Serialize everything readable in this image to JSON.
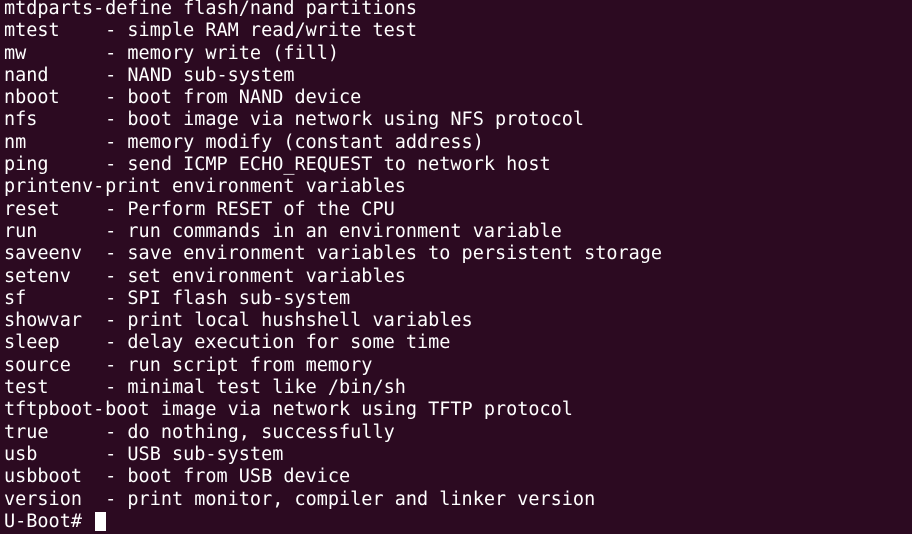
{
  "terminal": {
    "colors": {
      "background": "#2c0a21",
      "foreground": "#ffffff"
    },
    "lines": [
      {
        "cmd": "mtdparts-",
        "desc": " define flash/nand partitions"
      },
      {
        "cmd": "mtest   ",
        "desc": " - simple RAM read/write test"
      },
      {
        "cmd": "mw      ",
        "desc": " - memory write (fill)"
      },
      {
        "cmd": "nand    ",
        "desc": " - NAND sub-system"
      },
      {
        "cmd": "nboot   ",
        "desc": " - boot from NAND device"
      },
      {
        "cmd": "nfs     ",
        "desc": " - boot image via network using NFS protocol"
      },
      {
        "cmd": "nm      ",
        "desc": " - memory modify (constant address)"
      },
      {
        "cmd": "ping    ",
        "desc": " - send ICMP ECHO_REQUEST to network host"
      },
      {
        "cmd": "printenv-",
        "desc": " print environment variables"
      },
      {
        "cmd": "reset   ",
        "desc": " - Perform RESET of the CPU"
      },
      {
        "cmd": "run     ",
        "desc": " - run commands in an environment variable"
      },
      {
        "cmd": "saveenv ",
        "desc": " - save environment variables to persistent storage"
      },
      {
        "cmd": "setenv  ",
        "desc": " - set environment variables"
      },
      {
        "cmd": "sf      ",
        "desc": " - SPI flash sub-system"
      },
      {
        "cmd": "showvar ",
        "desc": " - print local hushshell variables"
      },
      {
        "cmd": "sleep   ",
        "desc": " - delay execution for some time"
      },
      {
        "cmd": "source  ",
        "desc": " - run script from memory"
      },
      {
        "cmd": "test    ",
        "desc": " - minimal test like /bin/sh"
      },
      {
        "cmd": "tftpboot-",
        "desc": " boot image via network using TFTP protocol"
      },
      {
        "cmd": "true    ",
        "desc": " - do nothing, successfully"
      },
      {
        "cmd": "usb     ",
        "desc": " - USB sub-system"
      },
      {
        "cmd": "usbboot ",
        "desc": " - boot from USB device"
      },
      {
        "cmd": "version ",
        "desc": " - print monitor, compiler and linker version"
      }
    ],
    "prompt": "U-Boot# "
  }
}
